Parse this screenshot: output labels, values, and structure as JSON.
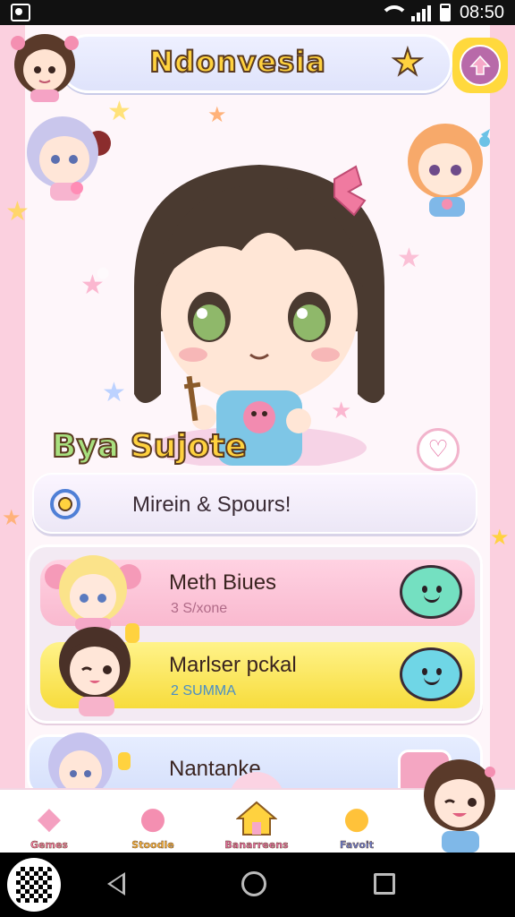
{
  "status_bar": {
    "time": "08:50"
  },
  "header": {
    "title": "Ndonvesia"
  },
  "hero": {
    "section_title_part1": "Bya",
    "section_title_part2": "Sujote"
  },
  "message": {
    "text": "Mirein & Spours!"
  },
  "list": [
    {
      "title": "Meth Biues",
      "subtitle": "3 S/xone"
    },
    {
      "title": "Marlser pckal",
      "subtitle": "2 SUMMA"
    },
    {
      "title": "Nantanke"
    }
  ],
  "tabs": [
    {
      "label": "Gemes"
    },
    {
      "label": "Stoodle"
    },
    {
      "label": "Banarreens"
    },
    {
      "label": "Favoit"
    }
  ],
  "colors": {
    "accent_yellow": "#ffd23f",
    "accent_pink": "#f9b9cf",
    "accent_purple": "#b86aa9",
    "mint": "#74e0c1"
  }
}
